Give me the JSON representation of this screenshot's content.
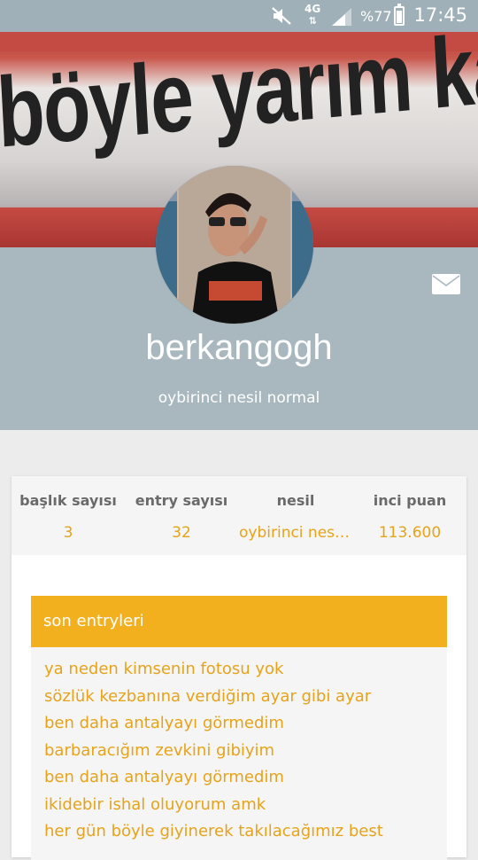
{
  "status_bar": {
    "network": "4G",
    "battery_text": "%77",
    "time": "17:45"
  },
  "cover": {
    "slogan": "böyle yarım ka"
  },
  "profile": {
    "username": "berkangogh",
    "generation": "oybirinci nesil normal"
  },
  "stats": [
    {
      "label": "başlık sayısı",
      "value": "3"
    },
    {
      "label": "entry sayısı",
      "value": "32"
    },
    {
      "label": "nesil",
      "value": "oybirinci nesil normal"
    },
    {
      "label": "inci puan",
      "value": "113.600"
    }
  ],
  "entries_section": {
    "title": "son entryleri",
    "items": [
      "ya neden kimsenin fotosu yok",
      "sözlük kezbanına verdiğim ayar gibi ayar",
      "ben daha antalyayı görmedim",
      "barbaracığım zevkini gibiyim",
      "ben daha antalyayı görmedim",
      "ikidebir ishal oluyorum amk",
      "her gün böyle giyinerek takılacağımız best"
    ]
  },
  "colors": {
    "accent": "#f2b01e",
    "link": "#e6a31a",
    "header": "#a9b8bf"
  },
  "icons": [
    "mute-icon",
    "signal-icon",
    "battery-icon",
    "mail-icon"
  ]
}
